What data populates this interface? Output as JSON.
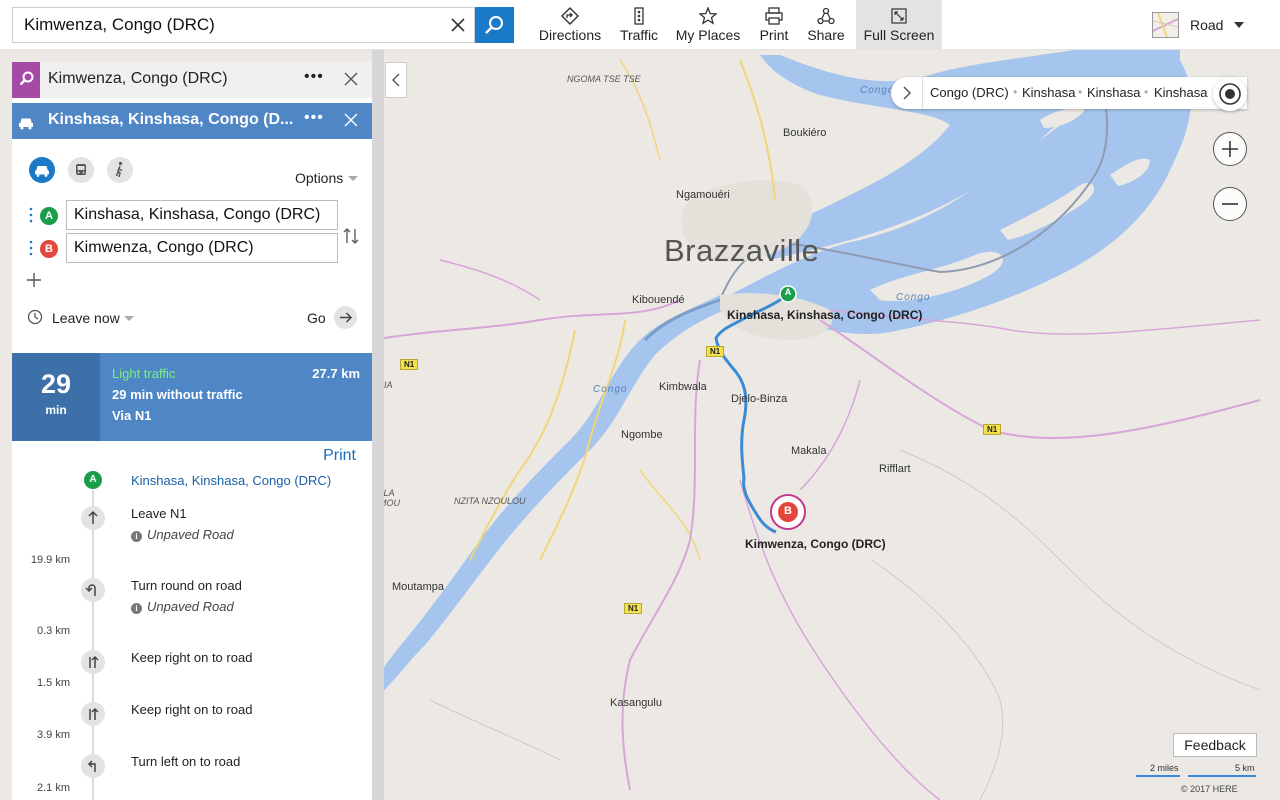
{
  "search": {
    "query": "Kimwenza, Congo (DRC)"
  },
  "toolbar": {
    "directions": "Directions",
    "traffic": "Traffic",
    "my_places": "My Places",
    "print": "Print",
    "share": "Share",
    "full_screen": "Full Screen"
  },
  "map_style": {
    "label": "Road"
  },
  "panel": {
    "search_card": {
      "title": "Kimwenza, Congo (DRC)",
      "more": "•••"
    },
    "directions_card": {
      "title": "Kinshasa, Kinshasa, Congo (D...",
      "more": "•••"
    },
    "options_label": "Options",
    "waypoint_a": {
      "badge": "A",
      "value": "Kinshasa, Kinshasa, Congo (DRC)"
    },
    "waypoint_b": {
      "badge": "B",
      "value": "Kimwenza, Congo (DRC)"
    },
    "leave_label": "Leave now",
    "go_label": "Go",
    "route": {
      "minutes": "29",
      "minutes_unit": "min",
      "traffic": "Light traffic",
      "distance": "27.7 km",
      "without_traffic": "29 min without traffic",
      "via": "Via N1"
    },
    "print_label": "Print",
    "steps": [
      {
        "badge": "A",
        "text": "Kinshasa, Kinshasa, Congo (DRC)"
      },
      {
        "text": "Leave N1",
        "note": "Unpaved Road",
        "distance": "19.9 km"
      },
      {
        "text": "Turn round on road",
        "note": "Unpaved Road",
        "distance": "0.3 km"
      },
      {
        "text": "Keep right on to road",
        "distance": "1.5 km"
      },
      {
        "text": "Keep right on to road",
        "distance": "3.9 km"
      },
      {
        "text": "Turn left on to road",
        "distance": "2.1 km"
      }
    ]
  },
  "breadcrumb": [
    "Congo (DRC)",
    "Kinshasa",
    "Kinshasa",
    "Kinshasa"
  ],
  "map": {
    "labels": {
      "brazzaville": "Brazzaville",
      "boukiero": "Boukiéro",
      "ngamoueri": "Ngamouéri",
      "kibouende": "Kibouendé",
      "kimbwala": "Kimbwala",
      "djelo_binza": "Djelo-Binza",
      "makala": "Makala",
      "rifflart": "Rifflart",
      "ngombe": "Ngombe",
      "moutampa": "Moutampa",
      "kasangulu": "Kasangulu",
      "ngoma_tse_tse": "NGOMA TSE TSE",
      "nzita_nzoulou": "NZITA NZOULOU",
      "congo_river_1": "Congo",
      "congo_river_2": "Congo",
      "congo_river_3": "Congo",
      "edge_1": "SSIA",
      "edge_2": "VALA",
      "edge_3": "OMOU"
    },
    "road_shields": [
      "N1",
      "N1",
      "N1",
      "N1"
    ],
    "pin_a_label": "Kinshasa, Kinshasa, Congo (DRC)",
    "pin_b_label": "Kimwenza, Congo (DRC)",
    "pin_a_badge": "A",
    "pin_b_badge": "B"
  },
  "feedback_label": "Feedback",
  "scale": {
    "miles": "2 miles",
    "km": "5 km"
  },
  "copyright": "© 2017 HERE",
  "colors": {
    "accent": "#1a7ac7",
    "route_line": "#3a8ad6",
    "water": "#a6c5ee",
    "pin_a": "#1b9e4b",
    "pin_b": "#e2463d",
    "light_traffic": "#7cf07c"
  }
}
